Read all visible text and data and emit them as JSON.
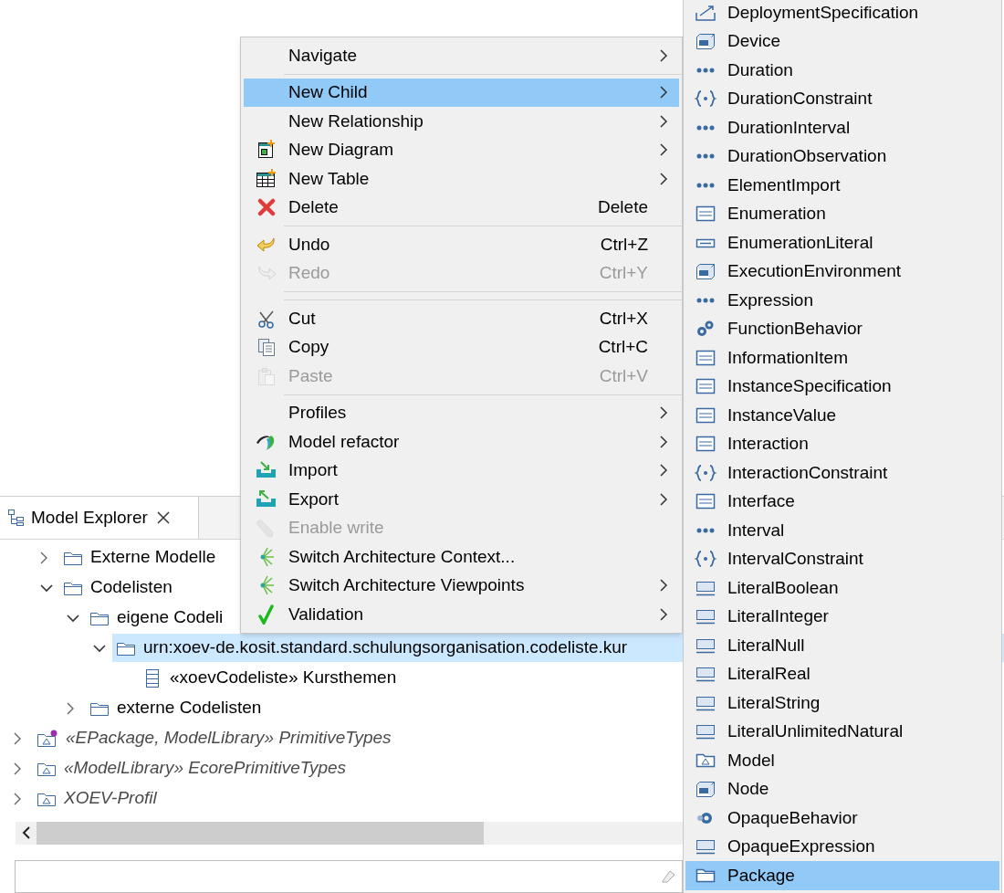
{
  "explorer": {
    "tab": {
      "title": "Model Explorer",
      "selected": true
    },
    "tree": [
      {
        "children": [
          {
            "label": "Externe Modelle",
            "kind": "folder",
            "expanded": false,
            "selected": false
          },
          {
            "label": "Codelisten",
            "kind": "folder",
            "expanded": true,
            "selected": false,
            "children": [
              {
                "label": "eigene Codeli",
                "kind": "folder",
                "expanded": true,
                "selected": false,
                "children": [
                  {
                    "label": "urn:xoev-de.kosit.standard.schulungsorganisation.codeliste.kur",
                    "kind": "folder",
                    "expanded": true,
                    "selected": true,
                    "children": [
                      {
                        "label": "«xoevCodeliste» Kursthemen",
                        "kind": "codelist",
                        "selected": false
                      }
                    ]
                  }
                ]
              },
              {
                "label": "externe Codelisten",
                "kind": "folder",
                "expanded": false,
                "selected": false
              }
            ]
          }
        ]
      },
      {
        "label": "«EPackage, ModelLibrary» PrimitiveTypes",
        "kind": "epackage-library",
        "expanded": false,
        "selected": false
      },
      {
        "label": "«ModelLibrary» EcorePrimitiveTypes",
        "kind": "model-library",
        "expanded": false,
        "selected": false
      },
      {
        "label": "XOEV-Profil",
        "kind": "model-library",
        "expanded": false,
        "selected": false
      }
    ]
  },
  "context_menu": {
    "items": [
      {
        "kind": "item",
        "label": "Navigate",
        "has_submenu": true,
        "selected": false,
        "disabled": false
      },
      {
        "kind": "separator"
      },
      {
        "kind": "item",
        "label": "New Child",
        "has_submenu": true,
        "selected": true,
        "disabled": false,
        "children": [
          {
            "label": "DeploymentSpecification",
            "selected": false
          },
          {
            "label": "Device",
            "selected": false
          },
          {
            "label": "Duration",
            "selected": false
          },
          {
            "label": "DurationConstraint",
            "selected": false
          },
          {
            "label": "DurationInterval",
            "selected": false
          },
          {
            "label": "DurationObservation",
            "selected": false
          },
          {
            "label": "ElementImport",
            "selected": false
          },
          {
            "label": "Enumeration",
            "selected": false
          },
          {
            "label": "EnumerationLiteral",
            "selected": false
          },
          {
            "label": "ExecutionEnvironment",
            "selected": false
          },
          {
            "label": "Expression",
            "selected": false
          },
          {
            "label": "FunctionBehavior",
            "selected": false
          },
          {
            "label": "InformationItem",
            "selected": false
          },
          {
            "label": "InstanceSpecification",
            "selected": false
          },
          {
            "label": "InstanceValue",
            "selected": false
          },
          {
            "label": "Interaction",
            "selected": false
          },
          {
            "label": "InteractionConstraint",
            "selected": false
          },
          {
            "label": "Interface",
            "selected": false
          },
          {
            "label": "Interval",
            "selected": false
          },
          {
            "label": "IntervalConstraint",
            "selected": false
          },
          {
            "label": "LiteralBoolean",
            "selected": false
          },
          {
            "label": "LiteralInteger",
            "selected": false
          },
          {
            "label": "LiteralNull",
            "selected": false
          },
          {
            "label": "LiteralReal",
            "selected": false
          },
          {
            "label": "LiteralString",
            "selected": false
          },
          {
            "label": "LiteralUnlimitedNatural",
            "selected": false
          },
          {
            "label": "Model",
            "selected": false
          },
          {
            "label": "Node",
            "selected": false
          },
          {
            "label": "OpaqueBehavior",
            "selected": false
          },
          {
            "label": "OpaqueExpression",
            "selected": false
          },
          {
            "label": "Package",
            "selected": true
          }
        ]
      },
      {
        "kind": "item",
        "label": "New Relationship",
        "has_submenu": true,
        "selected": false,
        "disabled": false
      },
      {
        "kind": "item",
        "label": "New Diagram",
        "has_submenu": true,
        "selected": false,
        "disabled": false
      },
      {
        "kind": "item",
        "label": "New Table",
        "has_submenu": true,
        "selected": false,
        "disabled": false
      },
      {
        "kind": "item",
        "label": "Delete",
        "shortcut": "Delete",
        "has_submenu": false,
        "selected": false,
        "disabled": false
      },
      {
        "kind": "separator"
      },
      {
        "kind": "item",
        "label": "Undo",
        "shortcut": "Ctrl+Z",
        "has_submenu": false,
        "selected": false,
        "disabled": false
      },
      {
        "kind": "item",
        "label": "Redo",
        "shortcut": "Ctrl+Y",
        "has_submenu": false,
        "selected": false,
        "disabled": true
      },
      {
        "kind": "separator"
      },
      {
        "kind": "separator"
      },
      {
        "kind": "item",
        "label": "Cut",
        "shortcut": "Ctrl+X",
        "has_submenu": false,
        "selected": false,
        "disabled": false
      },
      {
        "kind": "item",
        "label": "Copy",
        "shortcut": "Ctrl+C",
        "has_submenu": false,
        "selected": false,
        "disabled": false
      },
      {
        "kind": "item",
        "label": "Paste",
        "shortcut": "Ctrl+V",
        "has_submenu": false,
        "selected": false,
        "disabled": true
      },
      {
        "kind": "separator"
      },
      {
        "kind": "item",
        "label": "Profiles",
        "has_submenu": true,
        "selected": false,
        "disabled": false
      },
      {
        "kind": "item",
        "label": "Model refactor",
        "has_submenu": true,
        "selected": false,
        "disabled": false
      },
      {
        "kind": "item",
        "label": "Import",
        "has_submenu": true,
        "selected": false,
        "disabled": false
      },
      {
        "kind": "item",
        "label": "Export",
        "has_submenu": true,
        "selected": false,
        "disabled": false
      },
      {
        "kind": "item",
        "label": "Enable write",
        "has_submenu": false,
        "selected": false,
        "disabled": true
      },
      {
        "kind": "item",
        "label": "Switch Architecture Context...",
        "has_submenu": false,
        "selected": false,
        "disabled": false
      },
      {
        "kind": "item",
        "label": "Switch Architecture Viewpoints",
        "has_submenu": true,
        "selected": false,
        "disabled": false
      },
      {
        "kind": "item",
        "label": "Validation",
        "has_submenu": true,
        "selected": false,
        "disabled": false
      }
    ]
  }
}
